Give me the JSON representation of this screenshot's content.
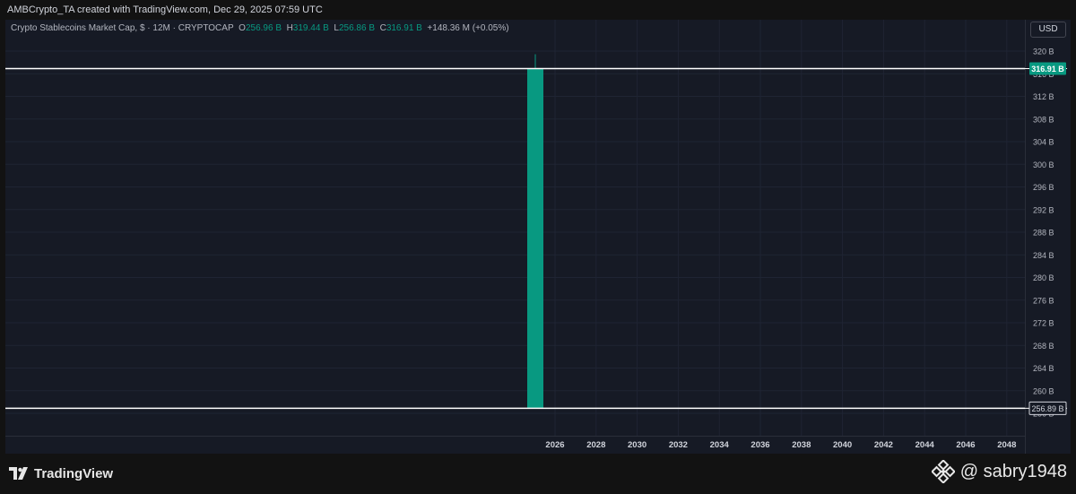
{
  "header": {
    "attribution": "AMBCrypto_TA created with TradingView.com, Dec 29, 2025 07:59 UTC"
  },
  "legend": {
    "symbol": "Crypto Stablecoins Market Cap, $ · 12M · CRYPTOCAP",
    "o_label": "O",
    "o_value": "256.96 B",
    "h_label": "H",
    "h_value": "319.44 B",
    "l_label": "L",
    "l_value": "256.86 B",
    "c_label": "C",
    "c_value": "316.91 B",
    "change": "+148.36 M (+0.05%)"
  },
  "currency_button": "USD",
  "footer": {
    "brand": "TradingView"
  },
  "watermark": {
    "text": "@ sabry1948"
  },
  "colors": {
    "background": "#161a25",
    "up_candle": "#089981",
    "text": "#d1d4dc",
    "grid": "#1f2433",
    "hline": "#ffffff"
  },
  "chart_data": {
    "type": "candlestick",
    "candles": [
      {
        "x": 2025,
        "open": 256.96,
        "high": 319.44,
        "low": 256.86,
        "close": 316.91
      }
    ],
    "ylim": [
      255,
      321
    ],
    "yticks": [
      320,
      316,
      312,
      308,
      304,
      300,
      296,
      292,
      288,
      284,
      280,
      276,
      272,
      268,
      264,
      260,
      256
    ],
    "ytick_labels": [
      "320 B",
      "316 B",
      "312 B",
      "308 B",
      "304 B",
      "300 B",
      "296 B",
      "292 B",
      "288 B",
      "284 B",
      "280 B",
      "276 B",
      "272 B",
      "268 B",
      "264 B",
      "260 B",
      "256 B"
    ],
    "xticks": [
      2026,
      2028,
      2030,
      2032,
      2034,
      2036,
      2038,
      2040,
      2042,
      2044,
      2046,
      2048
    ],
    "xtick_labels": [
      "2026",
      "2028",
      "2030",
      "2032",
      "2034",
      "2036",
      "2038",
      "2040",
      "2042",
      "2044",
      "2046",
      "2048"
    ],
    "hlines": [
      {
        "value": 316.91,
        "label": "316.91 B"
      },
      {
        "value": 256.89,
        "label": "256.89 B"
      }
    ],
    "grid": true
  }
}
